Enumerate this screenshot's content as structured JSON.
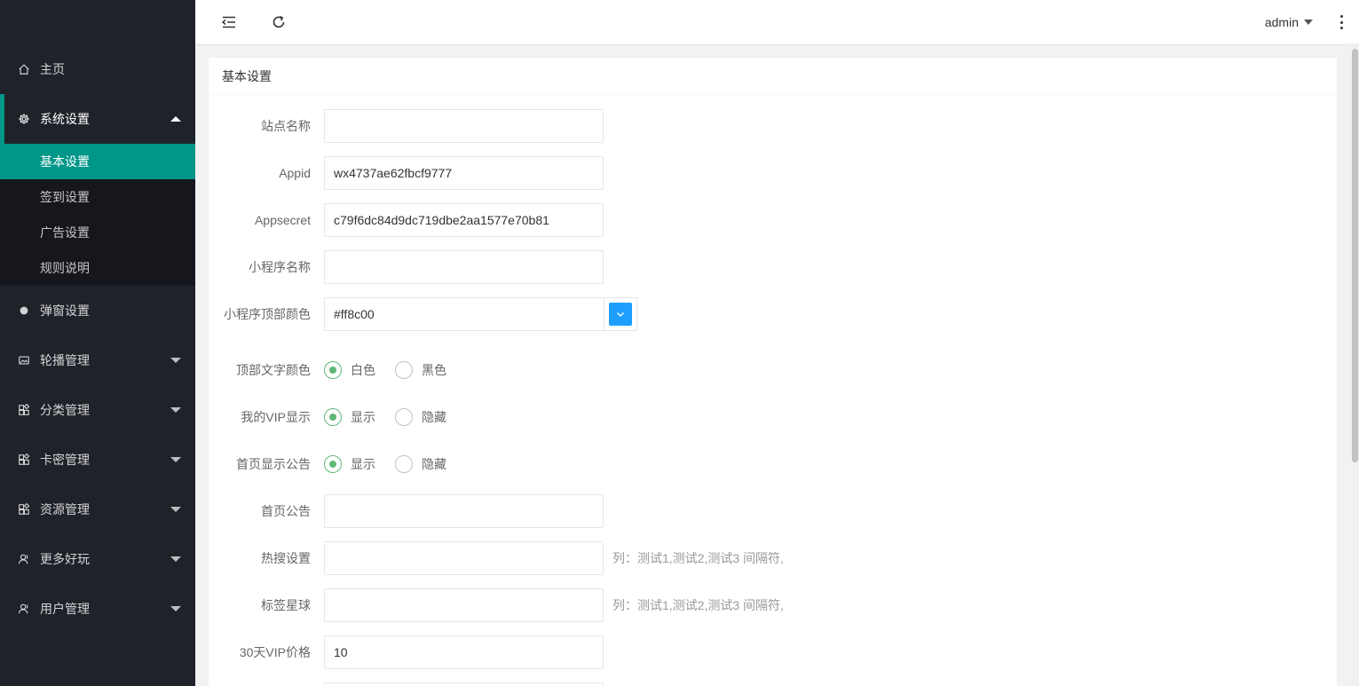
{
  "sidebar": {
    "logo_text": "",
    "items": [
      {
        "label": "主页",
        "icon": "home-icon"
      },
      {
        "label": "系统设置",
        "icon": "gear-icon"
      },
      {
        "label": "弹窗设置",
        "icon": "circle-icon"
      },
      {
        "label": "轮播管理",
        "icon": "image-icon"
      },
      {
        "label": "分类管理",
        "icon": "app-icon"
      },
      {
        "label": "卡密管理",
        "icon": "app-icon"
      },
      {
        "label": "资源管理",
        "icon": "app-icon"
      },
      {
        "label": "更多好玩",
        "icon": "user-icon"
      },
      {
        "label": "用户管理",
        "icon": "user-icon"
      }
    ],
    "submenu": [
      {
        "label": "基本设置"
      },
      {
        "label": "签到设置"
      },
      {
        "label": "广告设置"
      },
      {
        "label": "规则说明"
      }
    ]
  },
  "header": {
    "user": "admin"
  },
  "card": {
    "title": "基本设置"
  },
  "form": {
    "site_name": {
      "label": "站点名称",
      "value": ""
    },
    "appid": {
      "label": "Appid",
      "value": "wx4737ae62fbcf9777"
    },
    "appsecret": {
      "label": "Appsecret",
      "value": "c79f6dc84d9dc719dbe2aa1577e70b81"
    },
    "mini_name": {
      "label": "小程序名称",
      "value": ""
    },
    "top_color": {
      "label": "小程序顶部颜色",
      "value": "#ff8c00",
      "swatch": "#1e9fff"
    },
    "top_text_color": {
      "label": "顶部文字颜色",
      "options": [
        "白色",
        "黑色"
      ],
      "selected": "白色"
    },
    "vip_display": {
      "label": "我的VIP显示",
      "options": [
        "显示",
        "隐藏"
      ],
      "selected": "显示"
    },
    "notice_display": {
      "label": "首页显示公告",
      "options": [
        "显示",
        "隐藏"
      ],
      "selected": "显示"
    },
    "home_notice": {
      "label": "首页公告",
      "value": ""
    },
    "hot_search": {
      "label": "热搜设置",
      "value": "",
      "hint": "列：测试1,测试2,测试3 间隔符,"
    },
    "tag_planet": {
      "label": "标签星球",
      "value": "",
      "hint": "列：测试1,测试2,测试3 间隔符,"
    },
    "vip30_price": {
      "label": "30天VIP价格",
      "value": "10"
    }
  }
}
